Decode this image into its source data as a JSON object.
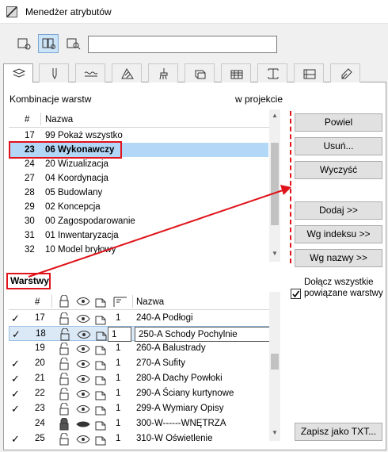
{
  "window": {
    "title": "Menedżer atrybutów"
  },
  "search": {
    "value": ""
  },
  "combinations": {
    "section_label": "Kombinacje warstw",
    "projection_label": "w projekcie",
    "col_num": "#",
    "col_name": "Nazwa",
    "rows": [
      {
        "num": "17",
        "name": "99 Pokaż wszystko"
      },
      {
        "num": "23",
        "name": "06 Wykonawczy"
      },
      {
        "num": "24",
        "name": "20 Wizualizacja"
      },
      {
        "num": "27",
        "name": "04 Koordynacja"
      },
      {
        "num": "28",
        "name": "05 Budowlany"
      },
      {
        "num": "29",
        "name": "02 Koncepcja"
      },
      {
        "num": "30",
        "name": "00 Zagospodarowanie"
      },
      {
        "num": "31",
        "name": "01 Inwentaryzacja"
      },
      {
        "num": "32",
        "name": "10 Model bryłowy"
      }
    ]
  },
  "buttons": {
    "duplicate": "Powiel",
    "delete": "Usuń...",
    "clear": "Wyczyść",
    "add": "Dodaj >>",
    "by_index": "Wg indeksu >>",
    "by_name": "Wg nazwy >>",
    "save_txt": "Zapisz jako TXT..."
  },
  "layers": {
    "section_label": "Warstwy",
    "col_num": "#",
    "col_name": "Nazwa",
    "include_all_label": "Dołącz wszystkie powiązane warstwy",
    "include_all_checked": true,
    "rows": [
      {
        "checked": true,
        "num": "17",
        "intersect": "1",
        "name": "240-A Podłogi",
        "locked": false,
        "visible": true
      },
      {
        "checked": true,
        "num": "18",
        "intersect": "1",
        "name": "250-A Schody Pochylnie",
        "locked": false,
        "visible": true
      },
      {
        "checked": false,
        "num": "19",
        "intersect": "1",
        "name": "260-A Balustrady",
        "locked": false,
        "visible": true
      },
      {
        "checked": true,
        "num": "20",
        "intersect": "1",
        "name": "270-A Sufity",
        "locked": false,
        "visible": true
      },
      {
        "checked": true,
        "num": "21",
        "intersect": "1",
        "name": "280-A Dachy Powłoki",
        "locked": false,
        "visible": true
      },
      {
        "checked": true,
        "num": "22",
        "intersect": "1",
        "name": "290-A Ściany kurtynowe",
        "locked": false,
        "visible": true
      },
      {
        "checked": true,
        "num": "23",
        "intersect": "1",
        "name": "299-A Wymiary Opisy",
        "locked": false,
        "visible": true
      },
      {
        "checked": false,
        "num": "24",
        "intersect": "1",
        "name": "300-W------WNĘTRZA",
        "locked": true,
        "visible": false
      },
      {
        "checked": true,
        "num": "25",
        "intersect": "1",
        "name": "310-W Oświetlenie",
        "locked": false,
        "visible": true
      }
    ]
  },
  "colors": {
    "highlight": "#e0131a",
    "selection": "#b3d7f7"
  }
}
